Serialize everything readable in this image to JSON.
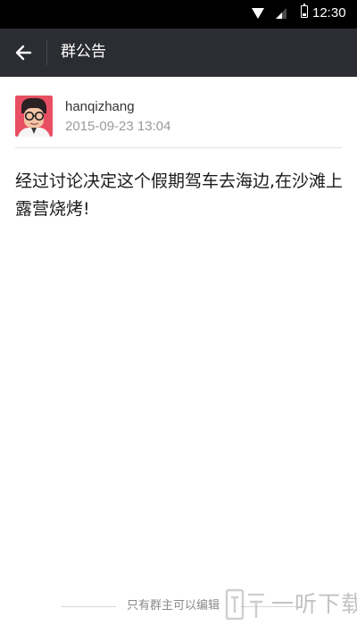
{
  "status_bar": {
    "time": "12:30",
    "icons": [
      "wifi-icon",
      "signal-icon",
      "battery-icon"
    ]
  },
  "header": {
    "title": "群公告",
    "back_icon": "arrow-left-icon"
  },
  "announcement": {
    "author": "hanqizhang",
    "timestamp": "2015-09-23 13:04",
    "content": "经过讨论决定这个假期驾车去海边,在沙滩上露营烧烤!"
  },
  "footer": {
    "note": "只有群主可以编辑"
  },
  "watermark": {
    "text": "一听下载"
  },
  "colors": {
    "status_bar": "#000000",
    "header_bg": "#2b2d32",
    "page_bg": "#ffffff",
    "timestamp": "#9a9a9a",
    "divider": "#e3e3e3"
  }
}
